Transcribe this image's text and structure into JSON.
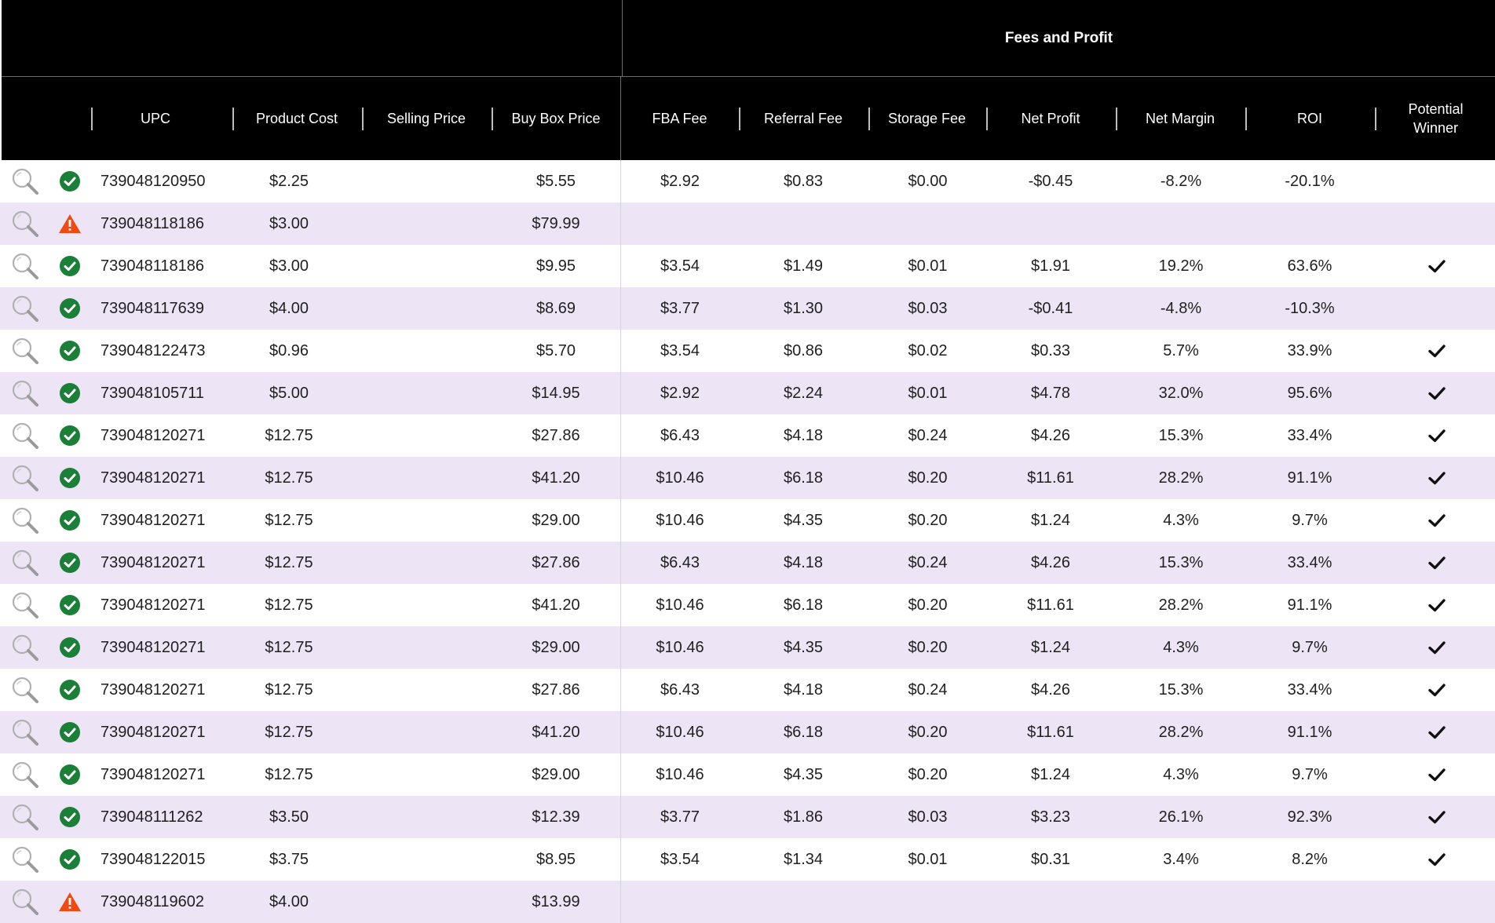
{
  "header": {
    "group_title": "Fees and Profit",
    "columns": {
      "upc": "UPC",
      "product_cost": "Product Cost",
      "selling_price": "Selling Price",
      "buy_box_price": "Buy Box Price",
      "fba_fee": "FBA Fee",
      "referral_fee": "Referral Fee",
      "storage_fee": "Storage Fee",
      "net_profit": "Net Profit",
      "net_margin": "Net Margin",
      "roi": "ROI",
      "potential_winner": "Potential Winner"
    }
  },
  "colors": {
    "header_bg": "#000000",
    "row_alt_bg": "#ede4f5",
    "ok_green": "#1a7f37",
    "warn_orange": "#f04a12"
  },
  "icons": {
    "lookup": "magnifier-icon",
    "ok": "check-circle-icon",
    "warn": "warning-triangle-icon",
    "winner": "checkmark-icon"
  },
  "rows": [
    {
      "status": "ok",
      "upc": "739048120950",
      "product_cost": "$2.25",
      "selling_price": "",
      "buy_box_price": "$5.55",
      "fba_fee": "$2.92",
      "referral_fee": "$0.83",
      "storage_fee": "$0.00",
      "net_profit": "-$0.45",
      "net_margin": "-8.2%",
      "roi": "-20.1%",
      "winner": false
    },
    {
      "status": "warn",
      "upc": "739048118186",
      "product_cost": "$3.00",
      "selling_price": "",
      "buy_box_price": "$79.99",
      "fba_fee": "",
      "referral_fee": "",
      "storage_fee": "",
      "net_profit": "",
      "net_margin": "",
      "roi": "",
      "winner": false
    },
    {
      "status": "ok",
      "upc": "739048118186",
      "product_cost": "$3.00",
      "selling_price": "",
      "buy_box_price": "$9.95",
      "fba_fee": "$3.54",
      "referral_fee": "$1.49",
      "storage_fee": "$0.01",
      "net_profit": "$1.91",
      "net_margin": "19.2%",
      "roi": "63.6%",
      "winner": true
    },
    {
      "status": "ok",
      "upc": "739048117639",
      "product_cost": "$4.00",
      "selling_price": "",
      "buy_box_price": "$8.69",
      "fba_fee": "$3.77",
      "referral_fee": "$1.30",
      "storage_fee": "$0.03",
      "net_profit": "-$0.41",
      "net_margin": "-4.8%",
      "roi": "-10.3%",
      "winner": false
    },
    {
      "status": "ok",
      "upc": "739048122473",
      "product_cost": "$0.96",
      "selling_price": "",
      "buy_box_price": "$5.70",
      "fba_fee": "$3.54",
      "referral_fee": "$0.86",
      "storage_fee": "$0.02",
      "net_profit": "$0.33",
      "net_margin": "5.7%",
      "roi": "33.9%",
      "winner": true
    },
    {
      "status": "ok",
      "upc": "739048105711",
      "product_cost": "$5.00",
      "selling_price": "",
      "buy_box_price": "$14.95",
      "fba_fee": "$2.92",
      "referral_fee": "$2.24",
      "storage_fee": "$0.01",
      "net_profit": "$4.78",
      "net_margin": "32.0%",
      "roi": "95.6%",
      "winner": true
    },
    {
      "status": "ok",
      "upc": "739048120271",
      "product_cost": "$12.75",
      "selling_price": "",
      "buy_box_price": "$27.86",
      "fba_fee": "$6.43",
      "referral_fee": "$4.18",
      "storage_fee": "$0.24",
      "net_profit": "$4.26",
      "net_margin": "15.3%",
      "roi": "33.4%",
      "winner": true
    },
    {
      "status": "ok",
      "upc": "739048120271",
      "product_cost": "$12.75",
      "selling_price": "",
      "buy_box_price": "$41.20",
      "fba_fee": "$10.46",
      "referral_fee": "$6.18",
      "storage_fee": "$0.20",
      "net_profit": "$11.61",
      "net_margin": "28.2%",
      "roi": "91.1%",
      "winner": true
    },
    {
      "status": "ok",
      "upc": "739048120271",
      "product_cost": "$12.75",
      "selling_price": "",
      "buy_box_price": "$29.00",
      "fba_fee": "$10.46",
      "referral_fee": "$4.35",
      "storage_fee": "$0.20",
      "net_profit": "$1.24",
      "net_margin": "4.3%",
      "roi": "9.7%",
      "winner": true
    },
    {
      "status": "ok",
      "upc": "739048120271",
      "product_cost": "$12.75",
      "selling_price": "",
      "buy_box_price": "$27.86",
      "fba_fee": "$6.43",
      "referral_fee": "$4.18",
      "storage_fee": "$0.24",
      "net_profit": "$4.26",
      "net_margin": "15.3%",
      "roi": "33.4%",
      "winner": true
    },
    {
      "status": "ok",
      "upc": "739048120271",
      "product_cost": "$12.75",
      "selling_price": "",
      "buy_box_price": "$41.20",
      "fba_fee": "$10.46",
      "referral_fee": "$6.18",
      "storage_fee": "$0.20",
      "net_profit": "$11.61",
      "net_margin": "28.2%",
      "roi": "91.1%",
      "winner": true
    },
    {
      "status": "ok",
      "upc": "739048120271",
      "product_cost": "$12.75",
      "selling_price": "",
      "buy_box_price": "$29.00",
      "fba_fee": "$10.46",
      "referral_fee": "$4.35",
      "storage_fee": "$0.20",
      "net_profit": "$1.24",
      "net_margin": "4.3%",
      "roi": "9.7%",
      "winner": true
    },
    {
      "status": "ok",
      "upc": "739048120271",
      "product_cost": "$12.75",
      "selling_price": "",
      "buy_box_price": "$27.86",
      "fba_fee": "$6.43",
      "referral_fee": "$4.18",
      "storage_fee": "$0.24",
      "net_profit": "$4.26",
      "net_margin": "15.3%",
      "roi": "33.4%",
      "winner": true
    },
    {
      "status": "ok",
      "upc": "739048120271",
      "product_cost": "$12.75",
      "selling_price": "",
      "buy_box_price": "$41.20",
      "fba_fee": "$10.46",
      "referral_fee": "$6.18",
      "storage_fee": "$0.20",
      "net_profit": "$11.61",
      "net_margin": "28.2%",
      "roi": "91.1%",
      "winner": true
    },
    {
      "status": "ok",
      "upc": "739048120271",
      "product_cost": "$12.75",
      "selling_price": "",
      "buy_box_price": "$29.00",
      "fba_fee": "$10.46",
      "referral_fee": "$4.35",
      "storage_fee": "$0.20",
      "net_profit": "$1.24",
      "net_margin": "4.3%",
      "roi": "9.7%",
      "winner": true
    },
    {
      "status": "ok",
      "upc": "739048111262",
      "product_cost": "$3.50",
      "selling_price": "",
      "buy_box_price": "$12.39",
      "fba_fee": "$3.77",
      "referral_fee": "$1.86",
      "storage_fee": "$0.03",
      "net_profit": "$3.23",
      "net_margin": "26.1%",
      "roi": "92.3%",
      "winner": true
    },
    {
      "status": "ok",
      "upc": "739048122015",
      "product_cost": "$3.75",
      "selling_price": "",
      "buy_box_price": "$8.95",
      "fba_fee": "$3.54",
      "referral_fee": "$1.34",
      "storage_fee": "$0.01",
      "net_profit": "$0.31",
      "net_margin": "3.4%",
      "roi": "8.2%",
      "winner": true
    },
    {
      "status": "warn",
      "upc": "739048119602",
      "product_cost": "$4.00",
      "selling_price": "",
      "buy_box_price": "$13.99",
      "fba_fee": "",
      "referral_fee": "",
      "storage_fee": "",
      "net_profit": "",
      "net_margin": "",
      "roi": "",
      "winner": false
    }
  ]
}
